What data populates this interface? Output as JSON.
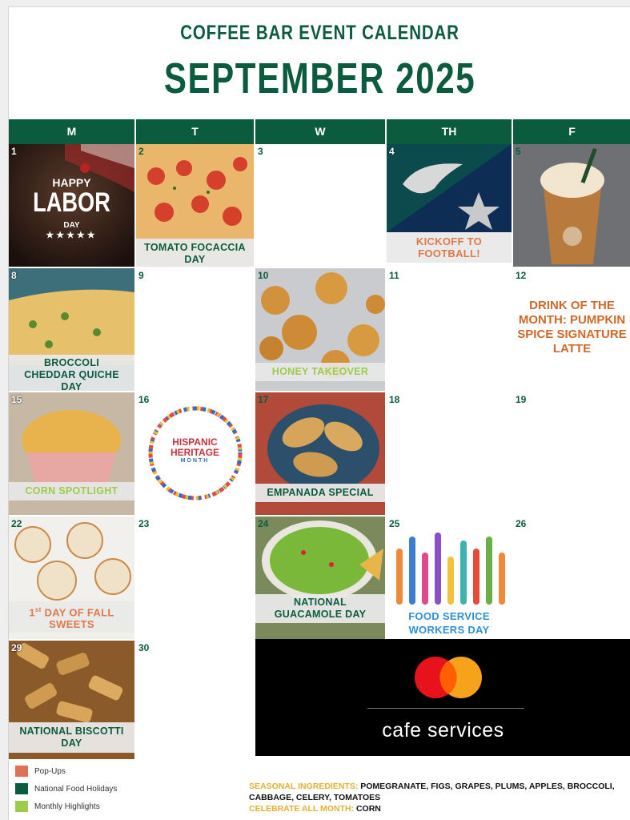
{
  "header": {
    "title": "COFFEE BAR EVENT CALENDAR",
    "month": "SEPTEMBER 2025"
  },
  "weekdays": [
    "M",
    "T",
    "W",
    "TH",
    "F"
  ],
  "days": {
    "d1": {
      "num": "1",
      "img_text": [
        "HAPPY",
        "LABOR",
        "DAY"
      ]
    },
    "d2": {
      "num": "2",
      "label": "TOMATO FOCACCIA DAY"
    },
    "d3": {
      "num": "3"
    },
    "d4": {
      "num": "4",
      "label": "KICKOFF TO FOOTBALL!"
    },
    "d5": {
      "num": "5"
    },
    "d8": {
      "num": "8",
      "label": "BROCCOLI CHEDDAR QUICHE DAY"
    },
    "d9": {
      "num": "9"
    },
    "d10": {
      "num": "10",
      "label": "HONEY TAKEOVER"
    },
    "d11": {
      "num": "11"
    },
    "d12": {
      "num": "12",
      "label": "DRINK OF THE MONTH: PUMPKIN SPICE SIGNATURE LATTE"
    },
    "d15": {
      "num": "15",
      "label": "CORN SPOTLIGHT"
    },
    "d16": {
      "num": "16",
      "logo_text": [
        "HISPANIC",
        "HERITAGE",
        "MONTH"
      ]
    },
    "d17": {
      "num": "17",
      "label": "EMPANADA SPECIAL"
    },
    "d18": {
      "num": "18"
    },
    "d19": {
      "num": "19"
    },
    "d22": {
      "num": "22",
      "label_sup": "st",
      "label_pre": "1",
      "label_post": " DAY OF FALL SWEETS"
    },
    "d23": {
      "num": "23"
    },
    "d24": {
      "num": "24",
      "label": "NATIONAL GUACAMOLE DAY"
    },
    "d25": {
      "num": "25",
      "label": "FOOD SERVICE WORKERS DAY"
    },
    "d26": {
      "num": "26"
    },
    "d29": {
      "num": "29",
      "label": "NATIONAL BISCOTTI DAY"
    },
    "d30": {
      "num": "30"
    }
  },
  "brand": {
    "name": "cafe services"
  },
  "legend": [
    {
      "label": "Pop-Ups",
      "color": "#e0705a"
    },
    {
      "label": "National Food Holidays",
      "color": "#0b5b3e"
    },
    {
      "label": "Monthly Highlights",
      "color": "#9ccc4a"
    }
  ],
  "footer": {
    "seasonal_label": "SEASONAL INGREDIENTS:",
    "seasonal_value": "POMEGRANATE, FIGS, GRAPES, PLUMS, APPLES, BROCCOLI, CABBAGE, CELERY, TOMATOES",
    "celebrate_label": "CELEBRATE ALL MONTH:",
    "celebrate_value": "CORN"
  },
  "colors": {
    "green": "#0b5b3e",
    "orange": "#e0784a",
    "lime": "#9ccc4a",
    "gold": "#e1b130"
  }
}
